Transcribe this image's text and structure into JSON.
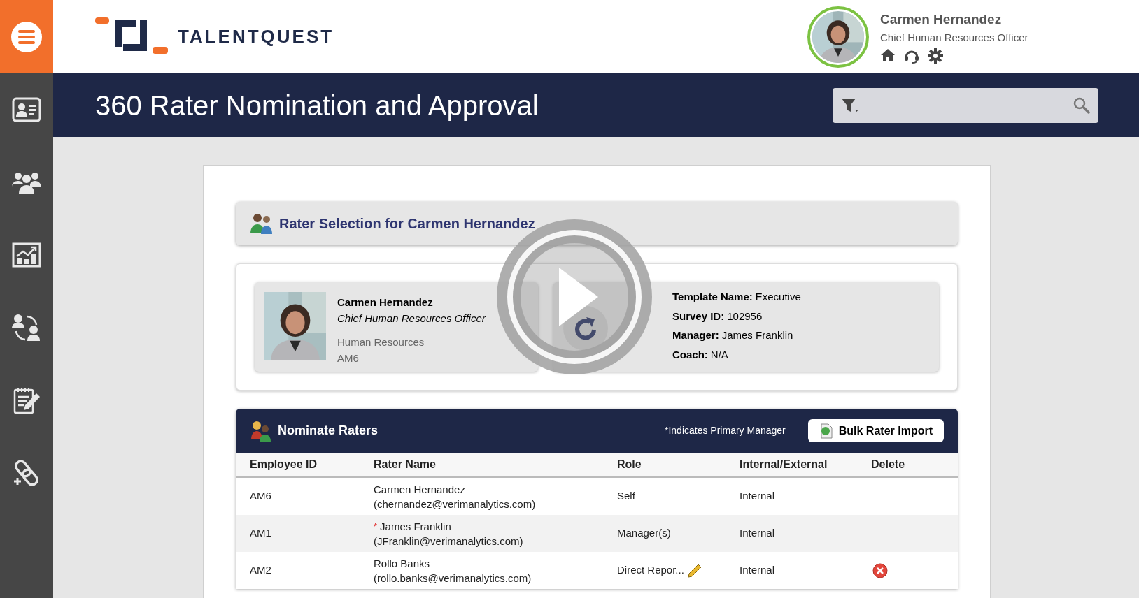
{
  "header": {
    "logo_text": "TALENTQUEST",
    "user": {
      "name": "Carmen Hernandez",
      "title": "Chief Human Resources Officer"
    }
  },
  "title_bar": {
    "title": "360 Rater Nomination and Approval"
  },
  "rater_selection": {
    "title": "Rater Selection for Carmen Hernandez"
  },
  "profile": {
    "name": "Carmen Hernandez",
    "title": "Chief Human Resources Officer",
    "department": "Human Resources",
    "employee_id": "AM6"
  },
  "survey": {
    "fields": [
      {
        "label": "Template Name:",
        "value": "Executive"
      },
      {
        "label": "Survey ID:",
        "value": "102956"
      },
      {
        "label": "Manager:",
        "value": "James Franklin"
      },
      {
        "label": "Coach:",
        "value": "N/A"
      }
    ]
  },
  "nominate": {
    "title": "Nominate Raters",
    "note": "*Indicates Primary Manager",
    "import_button": "Bulk Rater Import",
    "primary_marker": "*",
    "columns": [
      "Employee ID",
      "Rater Name",
      "Role",
      "Internal/External",
      "Delete"
    ],
    "rows": [
      {
        "employee_id": "AM6",
        "name": "Carmen Hernandez",
        "email": "(chernandez@verimanalytics.com)",
        "primary": false,
        "role": "Self",
        "editable": false,
        "type": "Internal",
        "deletable": false
      },
      {
        "employee_id": "AM1",
        "name": "James Franklin",
        "email": "(JFranklin@verimanalytics.com)",
        "primary": true,
        "role": "Manager(s)",
        "editable": false,
        "type": "Internal",
        "deletable": false
      },
      {
        "employee_id": "AM2",
        "name": "Rollo Banks",
        "email": "(rollo.banks@verimanalytics.com)",
        "primary": false,
        "role": "Direct Repor...",
        "editable": true,
        "type": "Internal",
        "deletable": true
      }
    ]
  }
}
